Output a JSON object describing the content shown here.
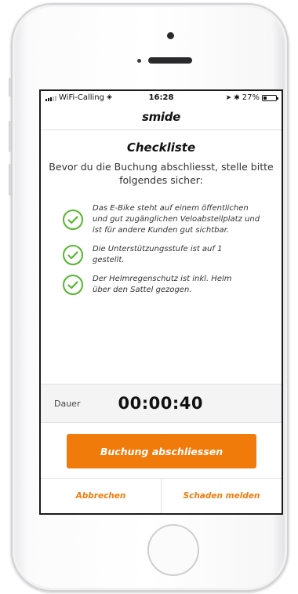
{
  "status_bar": {
    "carrier": "WiFi-Calling",
    "time": "16:28",
    "battery": "27%",
    "battery_level": 0.27
  },
  "app": {
    "logo": "smide"
  },
  "checklist": {
    "title": "Checkliste",
    "subtitle": "Bevor du die Buchung abschliesst, stelle bitte folgendes sicher:",
    "items": [
      {
        "text": "Das E-Bike steht auf einem öffentlichen und gut zugänglichen Veloabstellplatz und ist für andere Kunden gut sichtbar.",
        "icon": "check-circle-icon"
      },
      {
        "text": "Die Unterstützungsstufe ist auf 1 gestellt.",
        "icon": "check-circle-icon"
      },
      {
        "text": "Der Helmregenschutz ist inkl. Helm über den Sattel gezogen.",
        "icon": "check-circle-icon"
      }
    ]
  },
  "duration": {
    "label": "Dauer",
    "value": "00:00:40"
  },
  "actions": {
    "primary": "Buchung abschliessen",
    "cancel": "Abbrechen",
    "report_damage": "Schaden melden"
  },
  "colors": {
    "accent": "#f07b0b",
    "check": "#55b630"
  }
}
